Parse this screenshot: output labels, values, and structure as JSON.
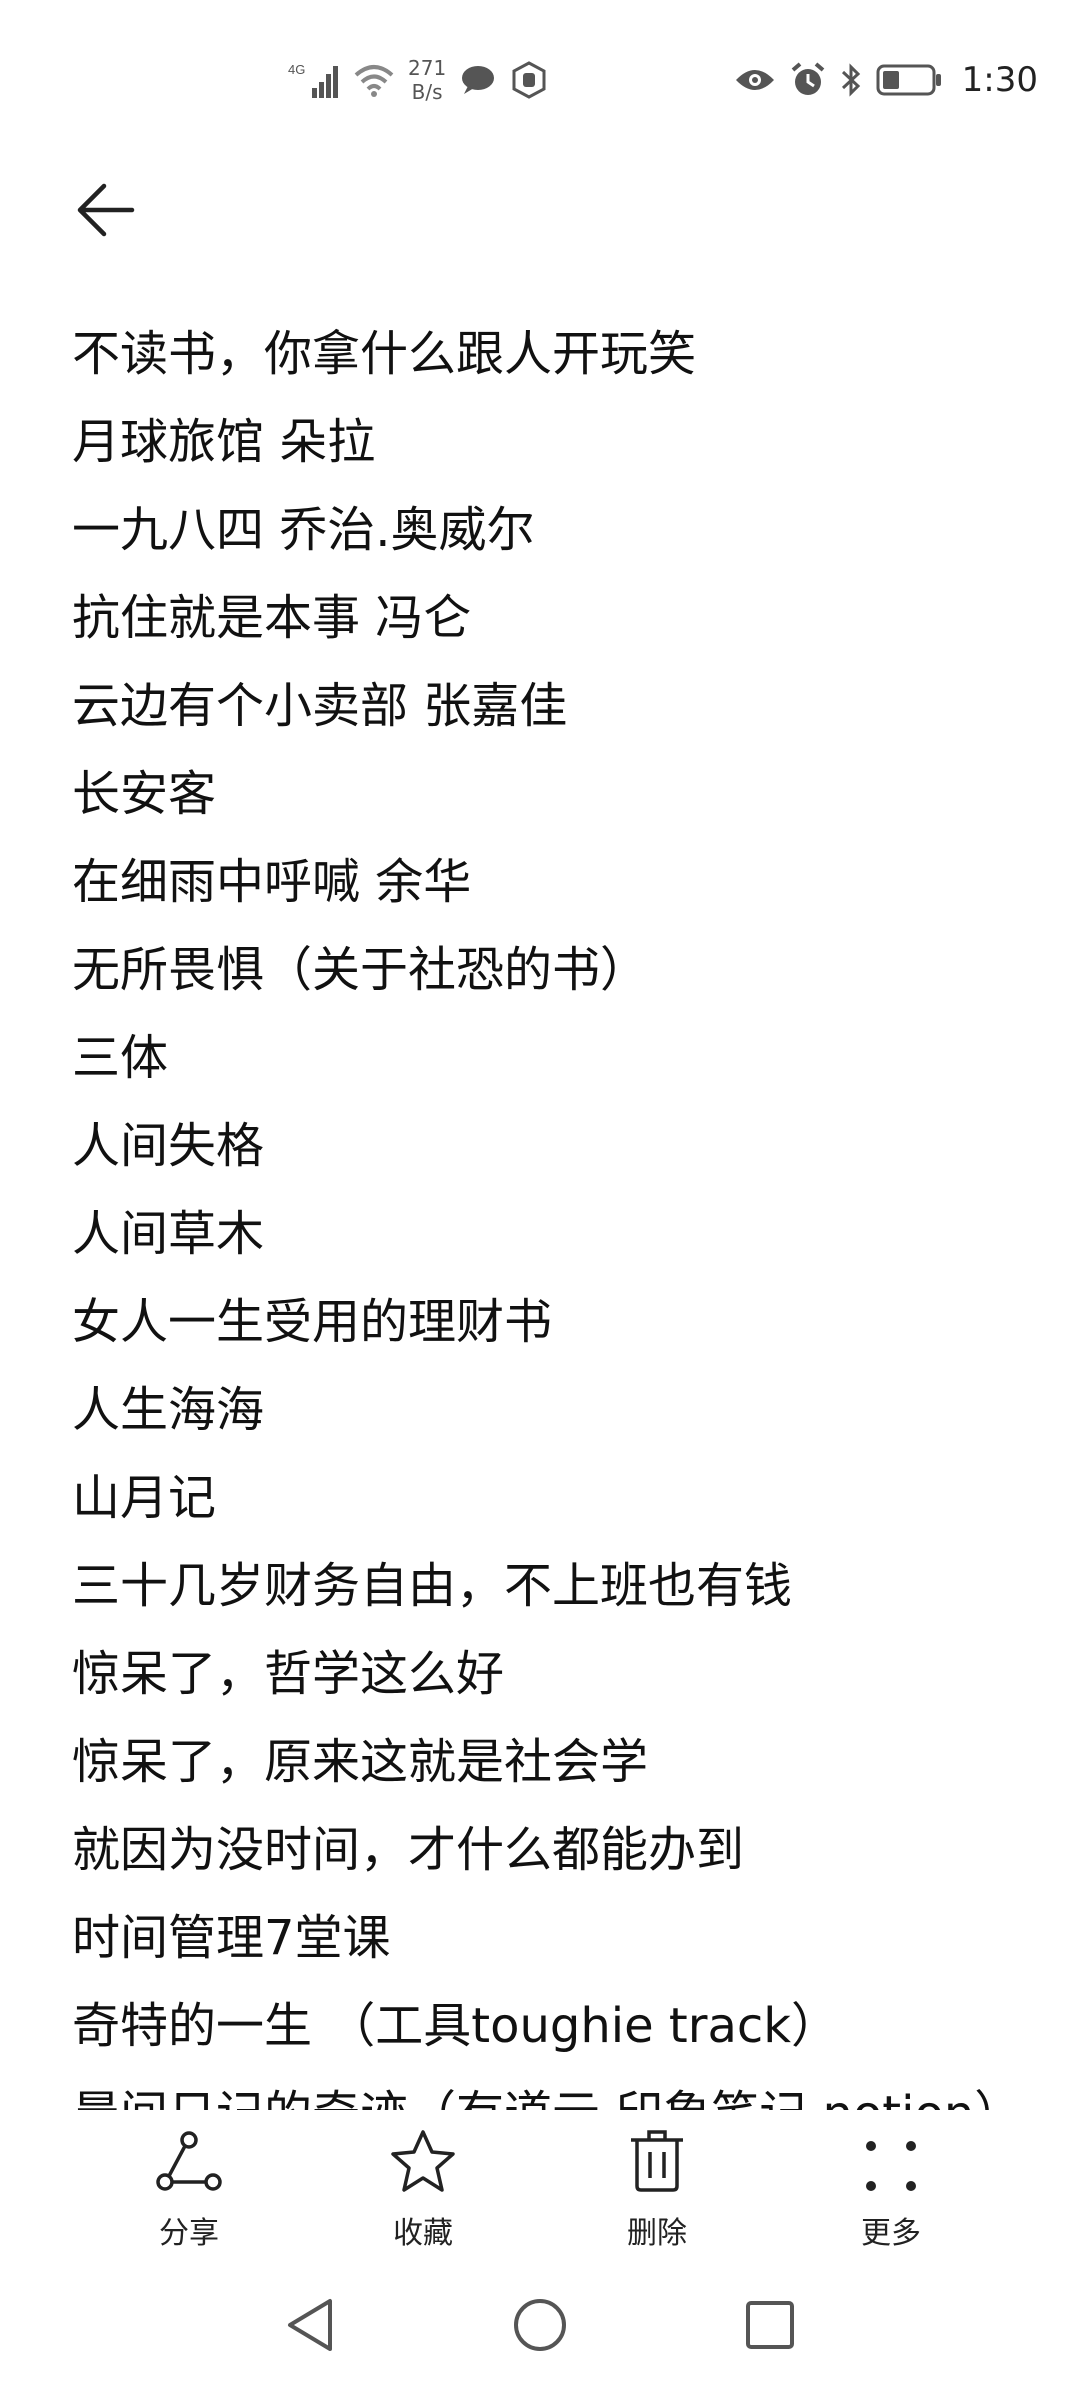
{
  "status_bar": {
    "network_type": "4G",
    "speed_value": "271",
    "speed_unit": "B/s",
    "time": "1:30",
    "icons": [
      "signal-icon",
      "wifi-icon",
      "message-icon",
      "hand-icon",
      "eye-icon",
      "alarm-icon",
      "bluetooth-icon",
      "battery-icon"
    ]
  },
  "header": {
    "back_icon": "arrow-left-icon"
  },
  "notes": [
    "不读书，你拿什么跟人开玩笑",
    "月球旅馆 朵拉",
    "一九八四 乔治.奥威尔",
    "抗住就是本事 冯仑",
    "云边有个小卖部 张嘉佳",
    "长安客",
    "在细雨中呼喊 余华",
    "无所畏惧（关于社恐的书）",
    "三体",
    "人间失格",
    "人间草木",
    "女人一生受用的理财书",
    "人生海海",
    "山月记",
    "三十几岁财务自由，不上班也有钱",
    "惊呆了，哲学这么好",
    "惊呆了，原来这就是社会学",
    "就因为没时间，才什么都能办到",
    "时间管理7堂课",
    "奇特的一生 （工具toughie track）",
    "晨间日记的奇迹（有道云 印象笔记 notion）"
  ],
  "actions": [
    {
      "label": "分享",
      "icon": "share-icon"
    },
    {
      "label": "收藏",
      "icon": "star-icon"
    },
    {
      "label": "删除",
      "icon": "trash-icon"
    },
    {
      "label": "更多",
      "icon": "more-icon"
    }
  ],
  "nav": {
    "back": "nav-back-icon",
    "home": "nav-home-icon",
    "recents": "nav-recents-icon"
  }
}
